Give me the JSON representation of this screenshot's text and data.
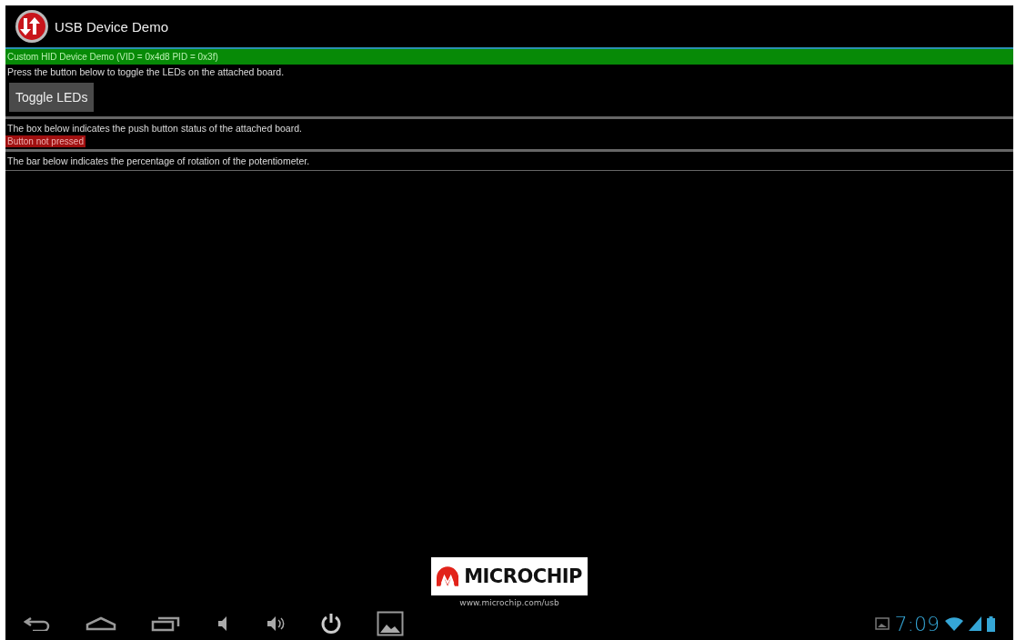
{
  "app_bar": {
    "title": "USB Device Demo"
  },
  "device_banner": "Custom HID Device Demo (VID = 0x4d8 PID = 0x3f)",
  "led_section": {
    "instruction": "Press the button below to toggle the LEDs on the attached board.",
    "button": "Toggle LEDs"
  },
  "push_button_section": {
    "instruction": "The box below indicates the push button status of the attached board.",
    "status": "Button not pressed",
    "pressed": false
  },
  "potentiometer_section": {
    "instruction": "The bar below indicates the percentage of rotation of the potentiometer."
  },
  "logo": {
    "name": "MICROCHIP",
    "url": "www.microchip.com/usb"
  },
  "system_bar": {
    "time": "7:09"
  }
}
